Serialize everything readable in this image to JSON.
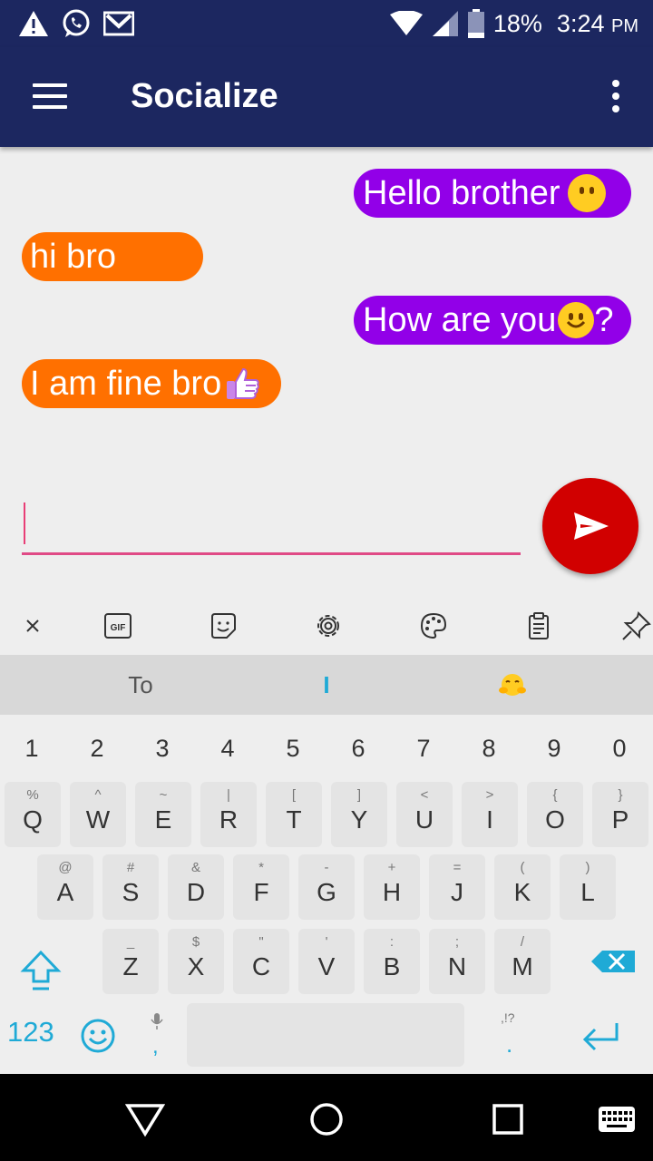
{
  "status_bar": {
    "battery": "18%",
    "time": "3:24",
    "time_suffix": "PM",
    "icons": [
      "warning-icon",
      "whatsapp-icon",
      "gmail-icon",
      "wifi-icon",
      "signal-icon",
      "battery-icon"
    ]
  },
  "app_bar": {
    "title": "Socialize"
  },
  "messages": [
    {
      "text": "Hello brother",
      "direction": "sent",
      "emoji": "neutral-face"
    },
    {
      "text": "hi bro",
      "direction": "received",
      "emoji": ""
    },
    {
      "text": "How are you",
      "suffix": "?",
      "direction": "sent",
      "emoji": "smiling-face"
    },
    {
      "text": "I am fine bro",
      "direction": "received",
      "emoji": "thumbs-up"
    }
  ],
  "composer": {
    "value": "",
    "placeholder": ""
  },
  "keyboard": {
    "suggestions": [
      "To",
      "I"
    ],
    "suggestion_emoji": "hugging-face",
    "numbers": [
      "1",
      "2",
      "3",
      "4",
      "5",
      "6",
      "7",
      "8",
      "9",
      "0"
    ],
    "row1": [
      {
        "k": "Q",
        "h": "%"
      },
      {
        "k": "W",
        "h": "^"
      },
      {
        "k": "E",
        "h": "~"
      },
      {
        "k": "R",
        "h": "|"
      },
      {
        "k": "T",
        "h": "["
      },
      {
        "k": "Y",
        "h": "]"
      },
      {
        "k": "U",
        "h": "<"
      },
      {
        "k": "I",
        "h": ">"
      },
      {
        "k": "O",
        "h": "{"
      },
      {
        "k": "P",
        "h": "}"
      }
    ],
    "row2": [
      {
        "k": "A",
        "h": "@"
      },
      {
        "k": "S",
        "h": "#"
      },
      {
        "k": "D",
        "h": "&"
      },
      {
        "k": "F",
        "h": "*"
      },
      {
        "k": "G",
        "h": "-"
      },
      {
        "k": "H",
        "h": "+"
      },
      {
        "k": "J",
        "h": "="
      },
      {
        "k": "K",
        "h": "("
      },
      {
        "k": "L",
        "h": ")"
      }
    ],
    "row3": [
      {
        "k": "Z",
        "h": "_"
      },
      {
        "k": "X",
        "h": "$"
      },
      {
        "k": "C",
        "h": "\""
      },
      {
        "k": "V",
        "h": "'"
      },
      {
        "k": "B",
        "h": ":"
      },
      {
        "k": "N",
        "h": ";"
      },
      {
        "k": "M",
        "h": "/"
      }
    ],
    "symbols_label": "123",
    "comma_label": ",",
    "period_label": ".",
    "period_hint": ",!?"
  },
  "colors": {
    "app_bar": "#1c2760",
    "sent_bubble": "#9200e8",
    "received_bubble": "#ff7000",
    "send_button": "#d10000",
    "input_accent": "#e04a86",
    "keyboard_accent": "#1faad6"
  }
}
